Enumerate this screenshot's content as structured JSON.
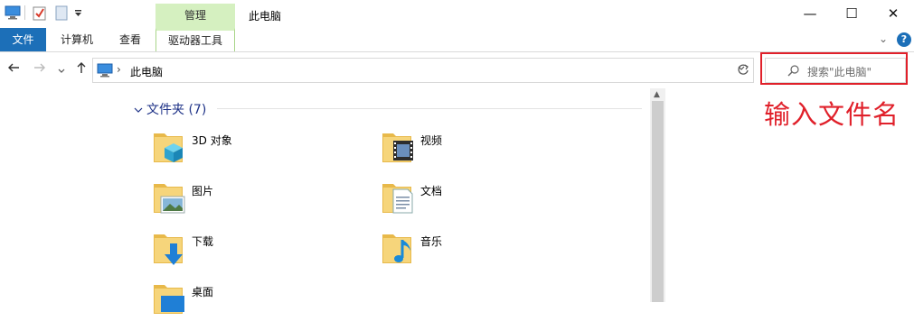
{
  "window": {
    "title": "此电脑",
    "context_tab_group": "管理",
    "minimize": "—",
    "maximize": "☐",
    "close": "✕"
  },
  "ribbon": {
    "tabs": [
      {
        "label": "文件"
      },
      {
        "label": "计算机"
      },
      {
        "label": "查看"
      },
      {
        "label": "驱动器工具"
      }
    ],
    "help": "?"
  },
  "address_bar": {
    "crumb_separator": "›",
    "location": "此电脑"
  },
  "search": {
    "placeholder": "搜索\"此电脑\""
  },
  "annotation_text": "输入文件名",
  "folders_group": {
    "header": "文件夹 (7)",
    "items": [
      {
        "label": "3D 对象",
        "icon": "3d-objects-folder-icon"
      },
      {
        "label": "视频",
        "icon": "videos-folder-icon"
      },
      {
        "label": "图片",
        "icon": "pictures-folder-icon"
      },
      {
        "label": "文档",
        "icon": "documents-folder-icon"
      },
      {
        "label": "下载",
        "icon": "downloads-folder-icon"
      },
      {
        "label": "音乐",
        "icon": "music-folder-icon"
      },
      {
        "label": "桌面",
        "icon": "desktop-folder-icon"
      }
    ]
  },
  "colors": {
    "accent": "#1c6fb8",
    "context_tab": "#d5f0c0",
    "annotation": "#e0202a",
    "group_header": "#1e3287"
  }
}
